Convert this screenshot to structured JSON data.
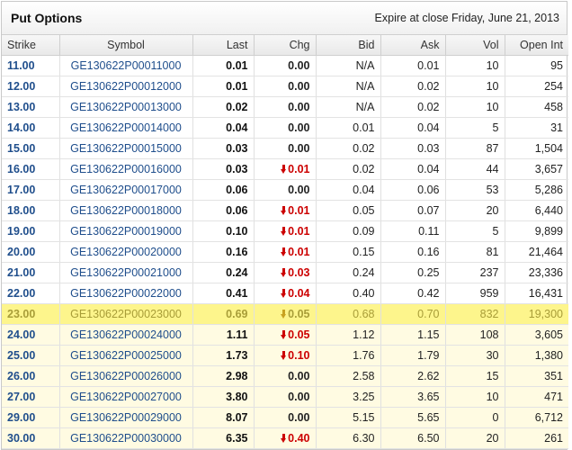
{
  "header": {
    "title": "Put Options",
    "expire_text": "Expire at close Friday, June 21, 2013"
  },
  "columns": [
    "Strike",
    "Symbol",
    "Last",
    "Chg",
    "Bid",
    "Ask",
    "Vol",
    "Open Int"
  ],
  "colors": {
    "link": "#1f4e8c",
    "negative": "#cc0000",
    "in_the_money_row": "#fffbe2",
    "at_the_money_row": "#fdf58c"
  },
  "rows": [
    {
      "strike": "11.00",
      "symbol": "GE130622P00011000",
      "last": "0.01",
      "chg": "0.00",
      "dir": "flat",
      "bid": "N/A",
      "ask": "0.01",
      "vol": "10",
      "open_int": "95",
      "state": "otm"
    },
    {
      "strike": "12.00",
      "symbol": "GE130622P00012000",
      "last": "0.01",
      "chg": "0.00",
      "dir": "flat",
      "bid": "N/A",
      "ask": "0.02",
      "vol": "10",
      "open_int": "254",
      "state": "otm"
    },
    {
      "strike": "13.00",
      "symbol": "GE130622P00013000",
      "last": "0.02",
      "chg": "0.00",
      "dir": "flat",
      "bid": "N/A",
      "ask": "0.02",
      "vol": "10",
      "open_int": "458",
      "state": "otm"
    },
    {
      "strike": "14.00",
      "symbol": "GE130622P00014000",
      "last": "0.04",
      "chg": "0.00",
      "dir": "flat",
      "bid": "0.01",
      "ask": "0.04",
      "vol": "5",
      "open_int": "31",
      "state": "otm"
    },
    {
      "strike": "15.00",
      "symbol": "GE130622P00015000",
      "last": "0.03",
      "chg": "0.00",
      "dir": "flat",
      "bid": "0.02",
      "ask": "0.03",
      "vol": "87",
      "open_int": "1,504",
      "state": "otm"
    },
    {
      "strike": "16.00",
      "symbol": "GE130622P00016000",
      "last": "0.03",
      "chg": "0.01",
      "dir": "down",
      "bid": "0.02",
      "ask": "0.04",
      "vol": "44",
      "open_int": "3,657",
      "state": "otm"
    },
    {
      "strike": "17.00",
      "symbol": "GE130622P00017000",
      "last": "0.06",
      "chg": "0.00",
      "dir": "flat",
      "bid": "0.04",
      "ask": "0.06",
      "vol": "53",
      "open_int": "5,286",
      "state": "otm"
    },
    {
      "strike": "18.00",
      "symbol": "GE130622P00018000",
      "last": "0.06",
      "chg": "0.01",
      "dir": "down",
      "bid": "0.05",
      "ask": "0.07",
      "vol": "20",
      "open_int": "6,440",
      "state": "otm"
    },
    {
      "strike": "19.00",
      "symbol": "GE130622P00019000",
      "last": "0.10",
      "chg": "0.01",
      "dir": "down",
      "bid": "0.09",
      "ask": "0.11",
      "vol": "5",
      "open_int": "9,899",
      "state": "otm"
    },
    {
      "strike": "20.00",
      "symbol": "GE130622P00020000",
      "last": "0.16",
      "chg": "0.01",
      "dir": "down",
      "bid": "0.15",
      "ask": "0.16",
      "vol": "81",
      "open_int": "21,464",
      "state": "otm"
    },
    {
      "strike": "21.00",
      "symbol": "GE130622P00021000",
      "last": "0.24",
      "chg": "0.03",
      "dir": "down",
      "bid": "0.24",
      "ask": "0.25",
      "vol": "237",
      "open_int": "23,336",
      "state": "otm"
    },
    {
      "strike": "22.00",
      "symbol": "GE130622P00022000",
      "last": "0.41",
      "chg": "0.04",
      "dir": "down",
      "bid": "0.40",
      "ask": "0.42",
      "vol": "959",
      "open_int": "16,431",
      "state": "otm"
    },
    {
      "strike": "23.00",
      "symbol": "GE130622P00023000",
      "last": "0.69",
      "chg": "0.05",
      "dir": "down",
      "bid": "0.68",
      "ask": "0.70",
      "vol": "832",
      "open_int": "19,300",
      "state": "atm"
    },
    {
      "strike": "24.00",
      "symbol": "GE130622P00024000",
      "last": "1.11",
      "chg": "0.05",
      "dir": "down",
      "bid": "1.12",
      "ask": "1.15",
      "vol": "108",
      "open_int": "3,605",
      "state": "itm"
    },
    {
      "strike": "25.00",
      "symbol": "GE130622P00025000",
      "last": "1.73",
      "chg": "0.10",
      "dir": "down",
      "bid": "1.76",
      "ask": "1.79",
      "vol": "30",
      "open_int": "1,380",
      "state": "itm"
    },
    {
      "strike": "26.00",
      "symbol": "GE130622P00026000",
      "last": "2.98",
      "chg": "0.00",
      "dir": "flat",
      "bid": "2.58",
      "ask": "2.62",
      "vol": "15",
      "open_int": "351",
      "state": "itm"
    },
    {
      "strike": "27.00",
      "symbol": "GE130622P00027000",
      "last": "3.80",
      "chg": "0.00",
      "dir": "flat",
      "bid": "3.25",
      "ask": "3.65",
      "vol": "10",
      "open_int": "471",
      "state": "itm"
    },
    {
      "strike": "29.00",
      "symbol": "GE130622P00029000",
      "last": "8.07",
      "chg": "0.00",
      "dir": "flat",
      "bid": "5.15",
      "ask": "5.65",
      "vol": "0",
      "open_int": "6,712",
      "state": "itm"
    },
    {
      "strike": "30.00",
      "symbol": "GE130622P00030000",
      "last": "6.35",
      "chg": "0.40",
      "dir": "down",
      "bid": "6.30",
      "ask": "6.50",
      "vol": "20",
      "open_int": "261",
      "state": "itm"
    }
  ]
}
